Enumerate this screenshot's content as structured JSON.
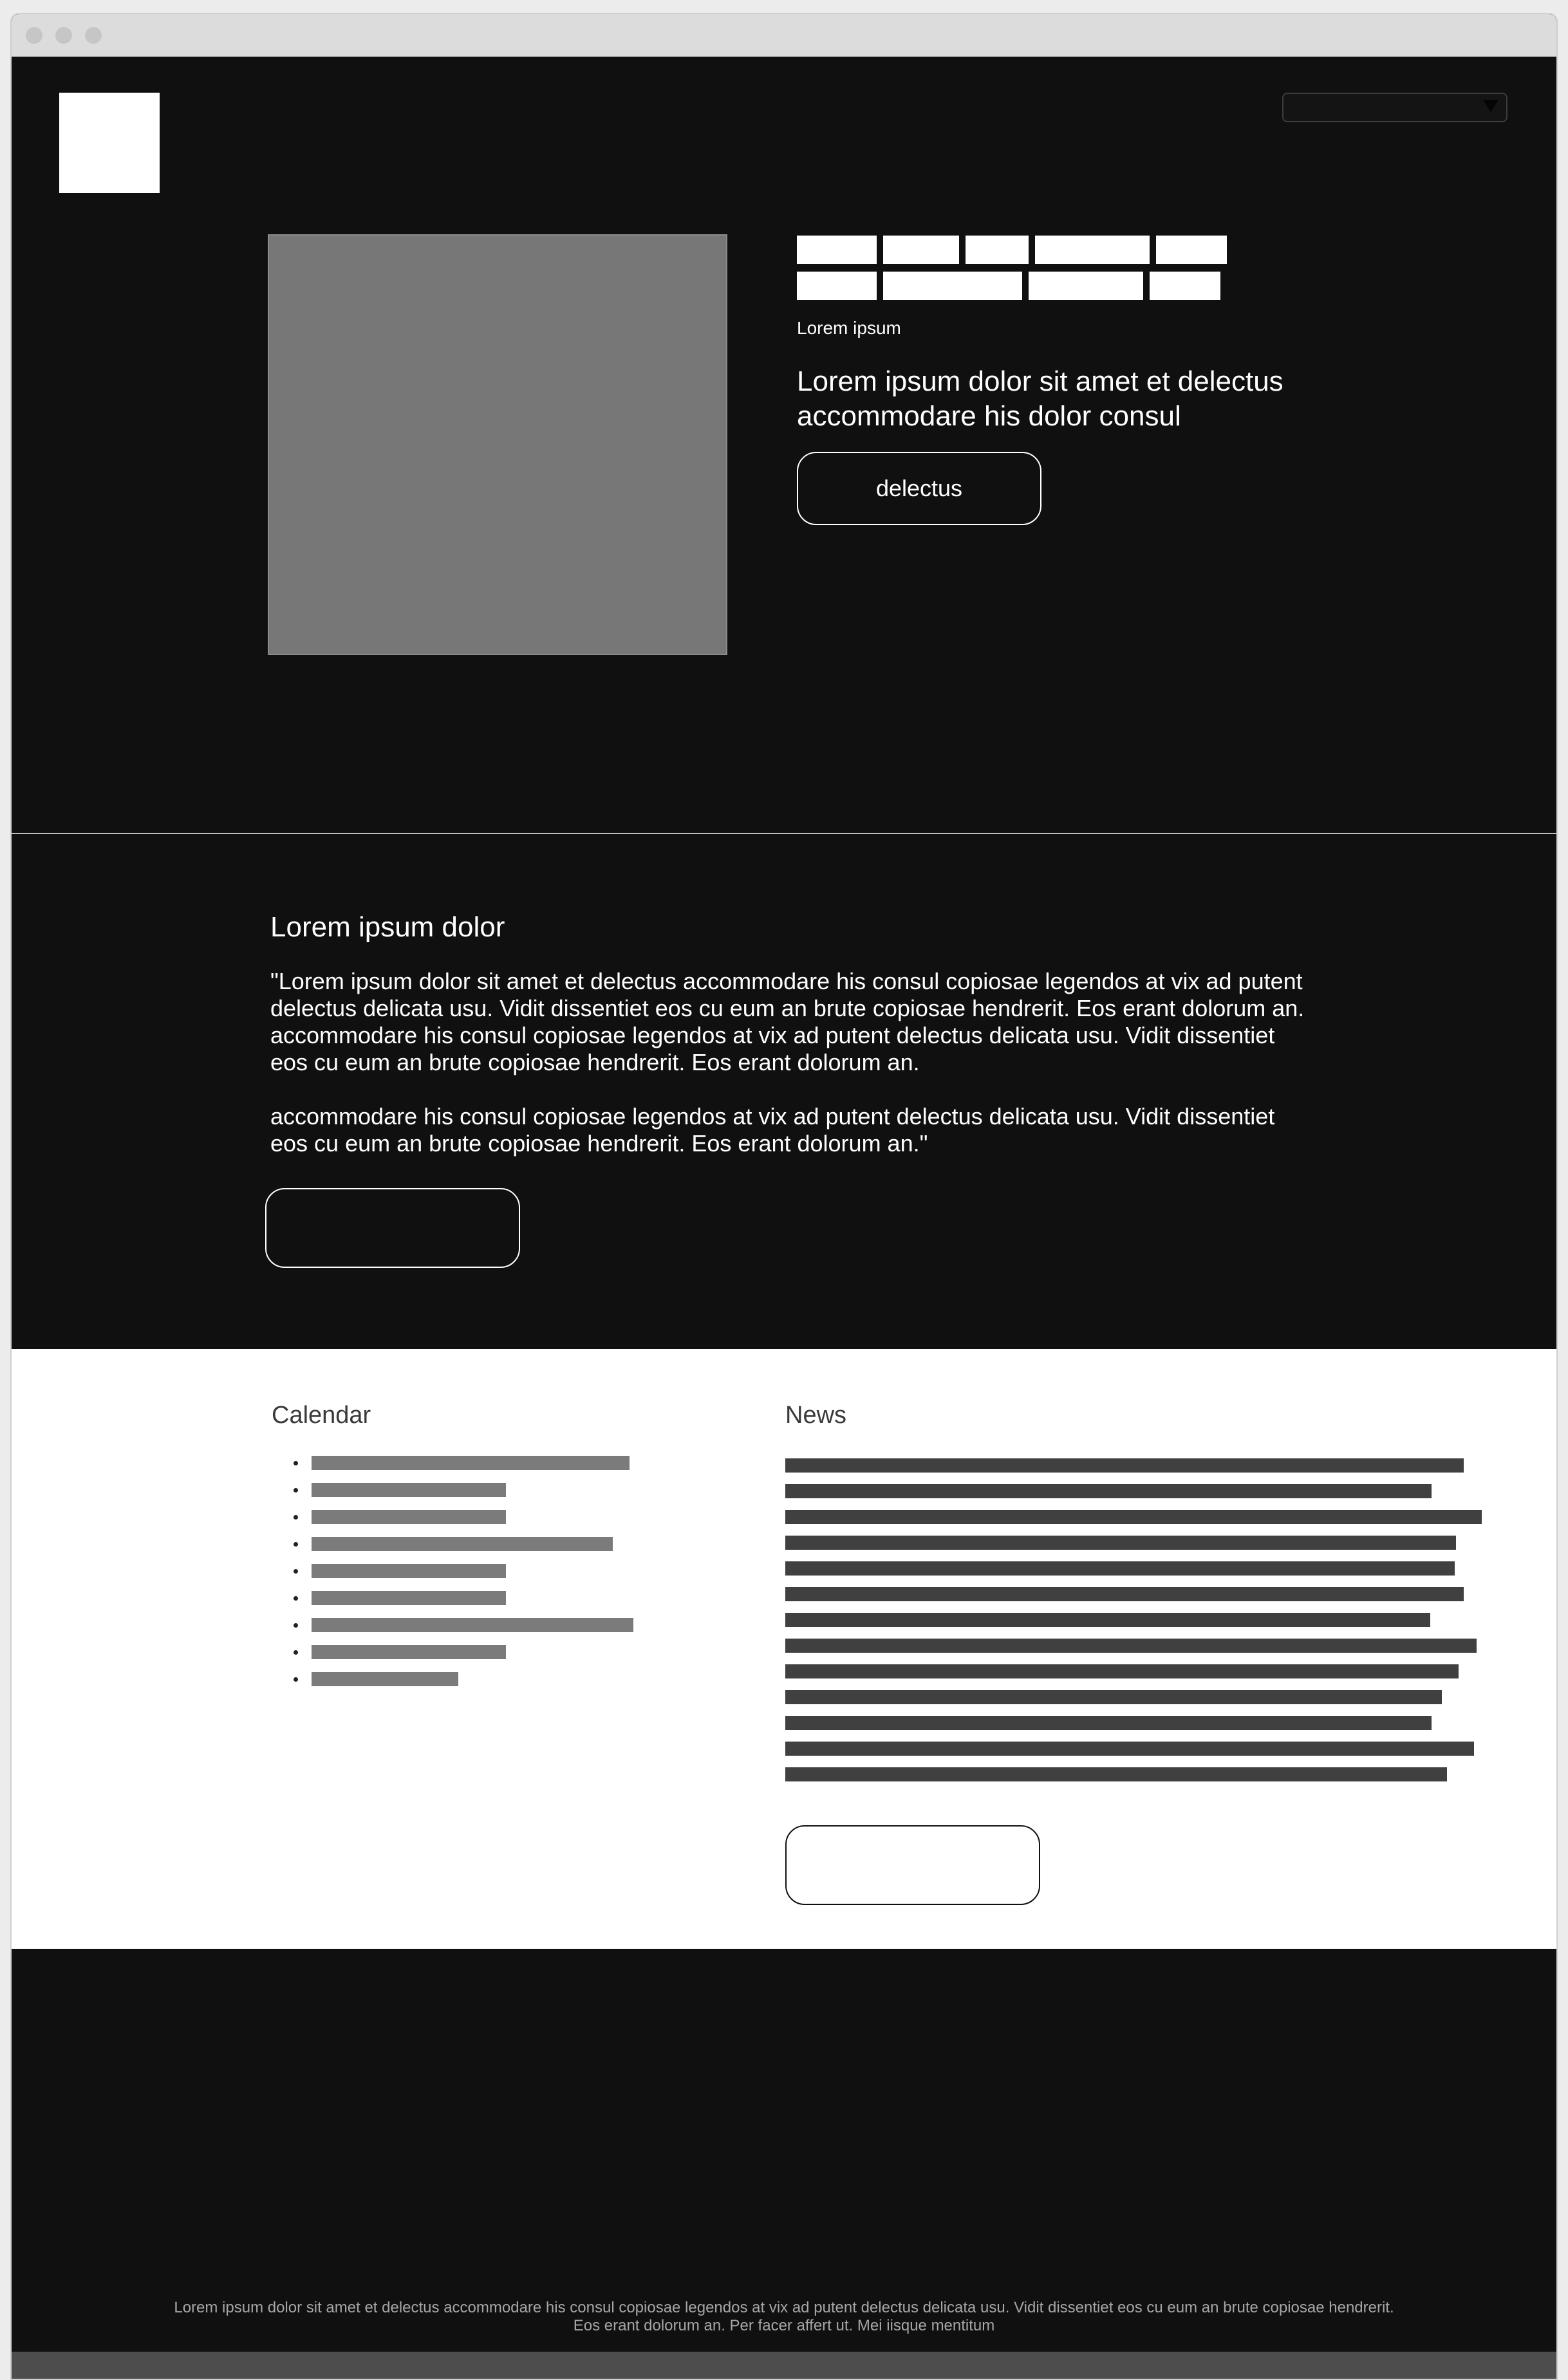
{
  "header": {
    "logo_alt": "logo",
    "dropdown_value": ""
  },
  "hero": {
    "eyebrow": "Lorem ipsum",
    "headline": "Lorem ipsum dolor sit amet et delectus accommodare his dolor consul",
    "cta_label": "delectus"
  },
  "about": {
    "title": "Lorem ipsum dolor",
    "paragraph_1": "\"Lorem ipsum dolor sit amet et delectus accommodare his consul copiosae legendos at vix ad putent delectus delicata usu. Vidit dissentiet eos cu eum an brute copiosae hendrerit. Eos erant dolorum an. accommodare his consul copiosae legendos at vix ad putent delectus delicata usu. Vidit dissentiet eos cu eum an brute copiosae hendrerit. Eos erant dolorum an.",
    "paragraph_2": "accommodare his consul copiosae legendos at vix ad putent delectus delicata usu. Vidit dissentiet eos cu eum an brute copiosae hendrerit. Eos erant dolorum an.\"",
    "button_label": ""
  },
  "calendar": {
    "title": "Calendar",
    "items_count": 9
  },
  "news": {
    "title": "News",
    "lines_count": 13,
    "button_label": ""
  },
  "footer": {
    "line_1": "Lorem ipsum dolor sit amet et delectus accommodare his consul copiosae legendos at vix ad putent delectus delicata usu. Vidit dissentiet eos cu eum an brute copiosae hendrerit.",
    "line_2": "Eos erant dolorum an. Per facer affert ut. Mei iisque mentitum"
  },
  "colors": {
    "background_dark": "#101010",
    "panel_light": "#ffffff",
    "placeholder_gray": "#777777"
  }
}
